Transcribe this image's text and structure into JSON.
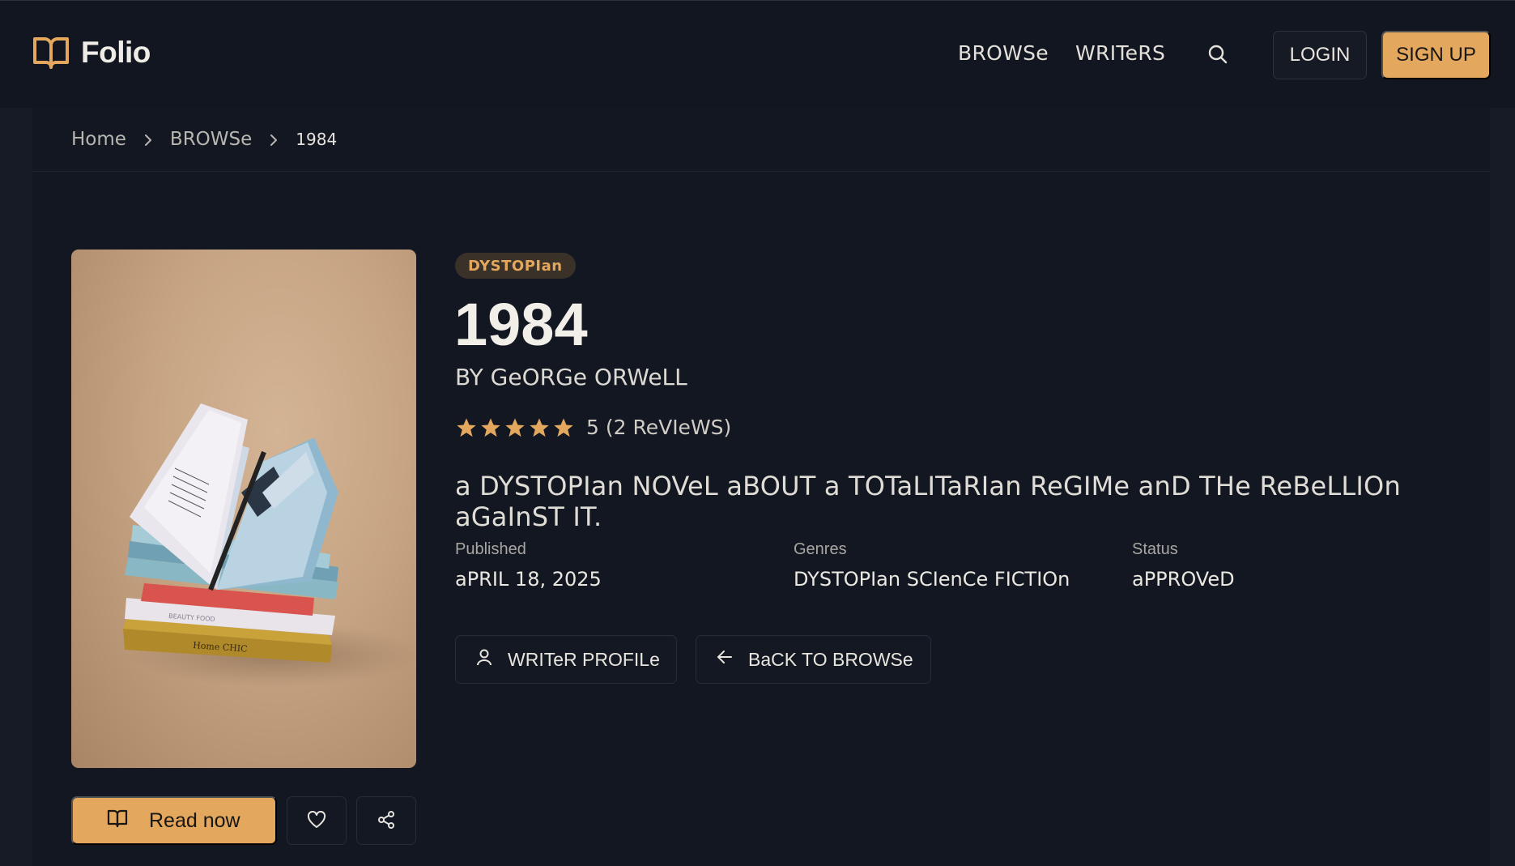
{
  "header": {
    "logo_text": "Folio",
    "nav": [
      {
        "label": "BROWSe"
      },
      {
        "label": "WRITeRS"
      }
    ],
    "login_label": "LOGIN",
    "signup_label": "SIGN UP"
  },
  "breadcrumb": {
    "items": [
      "Home",
      "BROWSe"
    ],
    "current": "1984"
  },
  "book": {
    "genre_tag": "DYSTOPIan",
    "title": "1984",
    "author_line": "BY GeORGe ORWeLL",
    "rating": 5,
    "rating_text": "5 (2 ReVIeWS)",
    "description": "a DYSTOPIan NOVeL aBOUT a TOTaLITaRIan ReGIMe anD THe ReBeLLIOn aGaInST IT.",
    "meta": [
      {
        "label": "Published",
        "value": "aPRIL 18, 2025"
      },
      {
        "label": "Genres",
        "value": "DYSTOPIan SCIenCe FICTIOn"
      },
      {
        "label": "Status",
        "value": "aPPROVeD"
      }
    ],
    "actions": {
      "writer_profile": "WRITeR PROFILe",
      "back_to_browse": "BaCK TO BROWSe"
    },
    "read_now_label": "Read now"
  },
  "colors": {
    "accent": "#e3a75e",
    "background": "#161b26",
    "panel": "#121722",
    "header": "#111621"
  },
  "icons": {
    "logo": "open-book-icon",
    "search": "search-icon",
    "breadcrumb_separator": "chevron-right-icon",
    "star": "star-icon",
    "writer": "user-icon",
    "back": "arrow-left-icon",
    "read": "book-icon",
    "favorite": "heart-icon",
    "share": "share-icon"
  }
}
